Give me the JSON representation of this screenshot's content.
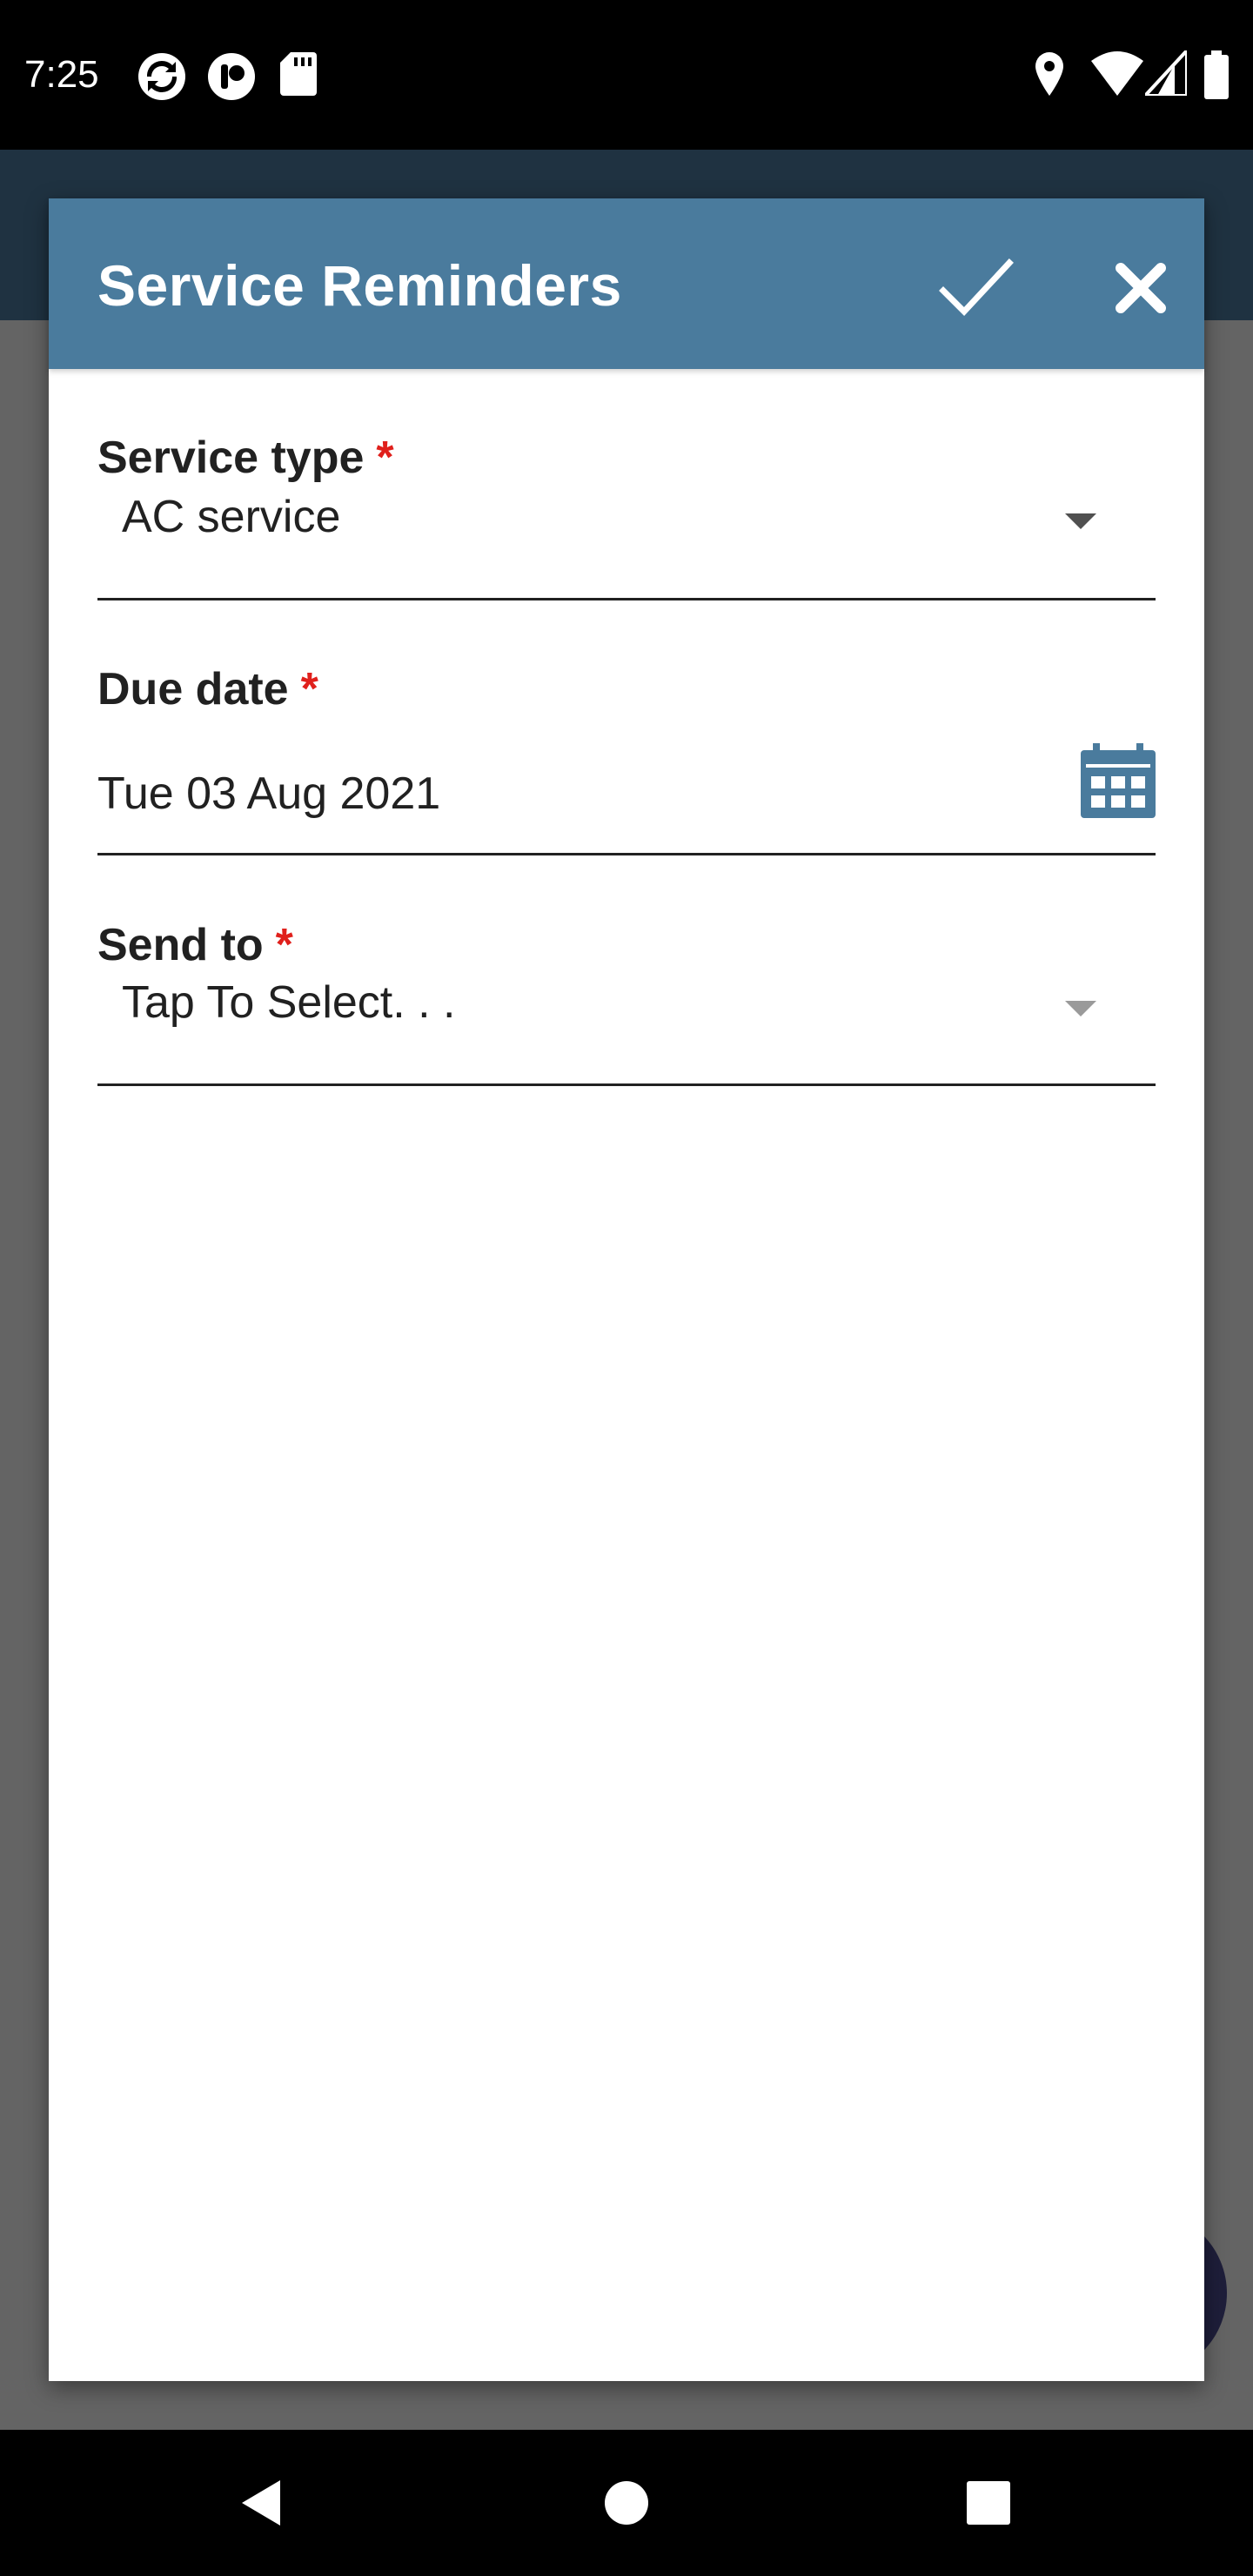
{
  "status_bar": {
    "time": "7:25",
    "left_icons": [
      "sync-icon",
      "app-badge-icon",
      "sd-card-icon"
    ],
    "right_icons": [
      "location-icon",
      "wifi-icon",
      "signal-icon",
      "battery-icon"
    ]
  },
  "dialog": {
    "title": "Service Reminders",
    "header_color": "#4a7b9d",
    "actions": [
      "check-icon",
      "close-icon"
    ]
  },
  "form": {
    "service_type": {
      "label": "Service type",
      "required_mark": "*",
      "value": "AC service"
    },
    "due_date": {
      "label": "Due date",
      "required_mark": "*",
      "value": "Tue 03 Aug 2021",
      "icon": "calendar-icon"
    },
    "send_to": {
      "label": "Send to",
      "required_mark": "*",
      "placeholder": "Tap To Select. . ."
    }
  },
  "nav_bar": {
    "buttons": [
      "back-icon",
      "home-icon",
      "recents-icon"
    ]
  },
  "colors": {
    "accent": "#4a7b9d",
    "required": "#e0201c",
    "text": "#212121"
  }
}
